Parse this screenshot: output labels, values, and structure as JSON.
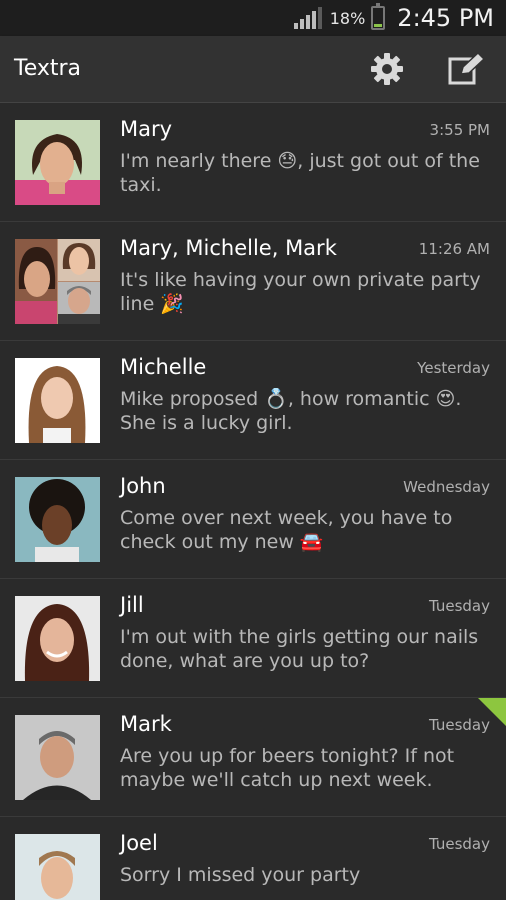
{
  "status_bar": {
    "battery_percent": "18%",
    "time": "2:45 PM",
    "battery_level": 0.18,
    "signal_bars": 4
  },
  "app_bar": {
    "title": "Textra",
    "settings_icon": "gear-icon",
    "compose_icon": "compose-icon"
  },
  "conversations": [
    {
      "name": "Mary",
      "time": "3:55 PM",
      "message": "I'm nearly there 😓, just got out of the taxi."
    },
    {
      "name": "Mary, Michelle, Mark",
      "time": "11:26 AM",
      "message": "It's like having your own private party line 🎉"
    },
    {
      "name": "Michelle",
      "time": "Yesterday",
      "message": "Mike proposed 💍, how romantic 😍. She is a lucky girl."
    },
    {
      "name": "John",
      "time": "Wednesday",
      "message": "Come over next week, you have to check out my new 🚘"
    },
    {
      "name": "Jill",
      "time": "Tuesday",
      "message": "I'm out with the girls getting our nails done, what are you up to?"
    },
    {
      "name": "Mark",
      "time": "Tuesday",
      "message": "Are you up for beers tonight? If not maybe we'll catch up next week.",
      "unread": true
    },
    {
      "name": "Joel",
      "time": "Tuesday",
      "message": "Sorry I missed your party"
    }
  ],
  "colors": {
    "accent": "#8dc63f",
    "background": "#2a2a2a",
    "app_bar": "#323232"
  }
}
